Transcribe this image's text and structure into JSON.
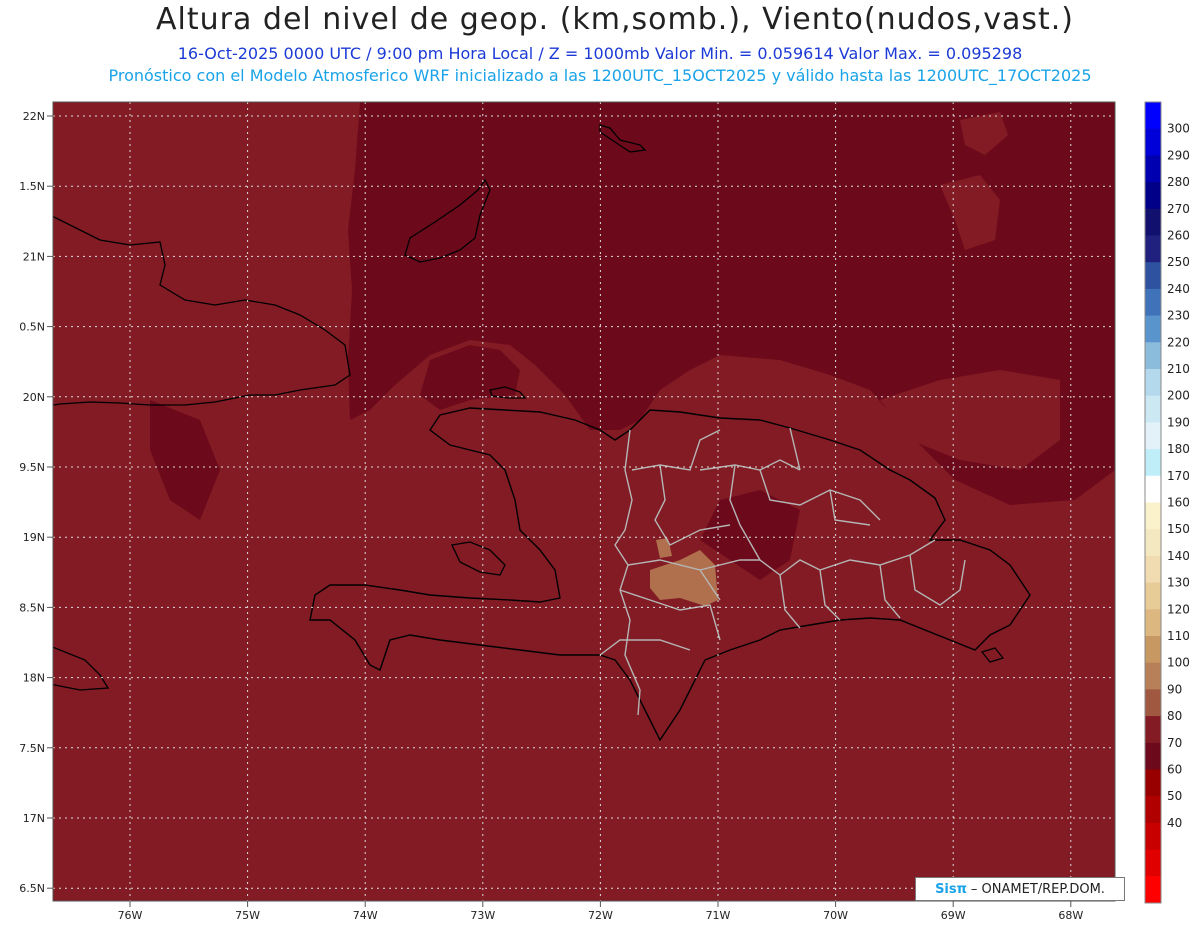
{
  "header": {
    "title": "Altura del nivel de geop. (km,somb.), Viento(nudos,vast.)",
    "line1": "16-Oct-2025  0000 UTC / 9:00 pm Hora Local / Z = 1000mb  Valor Min. = 0.059614  Valor Max. = 0.095298",
    "line2": "Pronóstico con el Modelo Atmosferico WRF inicializado a las 1200UTC_15OCT2025 y válido hasta las  1200UTC_17OCT2025"
  },
  "map": {
    "lat_labels": [
      "22N",
      "1.5N",
      "21N",
      "0.5N",
      "20N",
      "9.5N",
      "19N",
      "8.5N",
      "18N",
      "7.5N",
      "17N",
      "6.5N"
    ],
    "lon_labels": [
      "76W",
      "75W",
      "74W",
      "73W",
      "72W",
      "71W",
      "70W",
      "69W",
      "68W"
    ],
    "colors": {
      "base": "#821b23",
      "dark": "#6c0a1b",
      "brown": "#b0704e",
      "border": "#b5b5b5",
      "coast": "#000000"
    }
  },
  "colorbar": {
    "labels": [
      "300",
      "290",
      "280",
      "270",
      "260",
      "250",
      "240",
      "230",
      "220",
      "210",
      "200",
      "190",
      "180",
      "170",
      "160",
      "150",
      "140",
      "130",
      "120",
      "110",
      "100",
      "90",
      "80",
      "70",
      "60",
      "50",
      "40"
    ],
    "colors": [
      "#0000ff",
      "#0000d8",
      "#0000b0",
      "#000088",
      "#12106e",
      "#20207e",
      "#2e52a0",
      "#3f72b8",
      "#5a94cc",
      "#8cbcdc",
      "#b4d8ec",
      "#cce8f2",
      "#e2f2f8",
      "#c0eef8",
      "#ffffff",
      "#fbf2cc",
      "#f4e8c0",
      "#f0dcb0",
      "#e8cc98",
      "#dcb880",
      "#c89862",
      "#b88058",
      "#a05840",
      "#821b23",
      "#6c0a1b",
      "#980000",
      "#b00000",
      "#c80000",
      "#e00000",
      "#ff0000"
    ]
  },
  "credit": {
    "logo": "Sisπ",
    "text": "– ONAMET/REP.DOM."
  }
}
